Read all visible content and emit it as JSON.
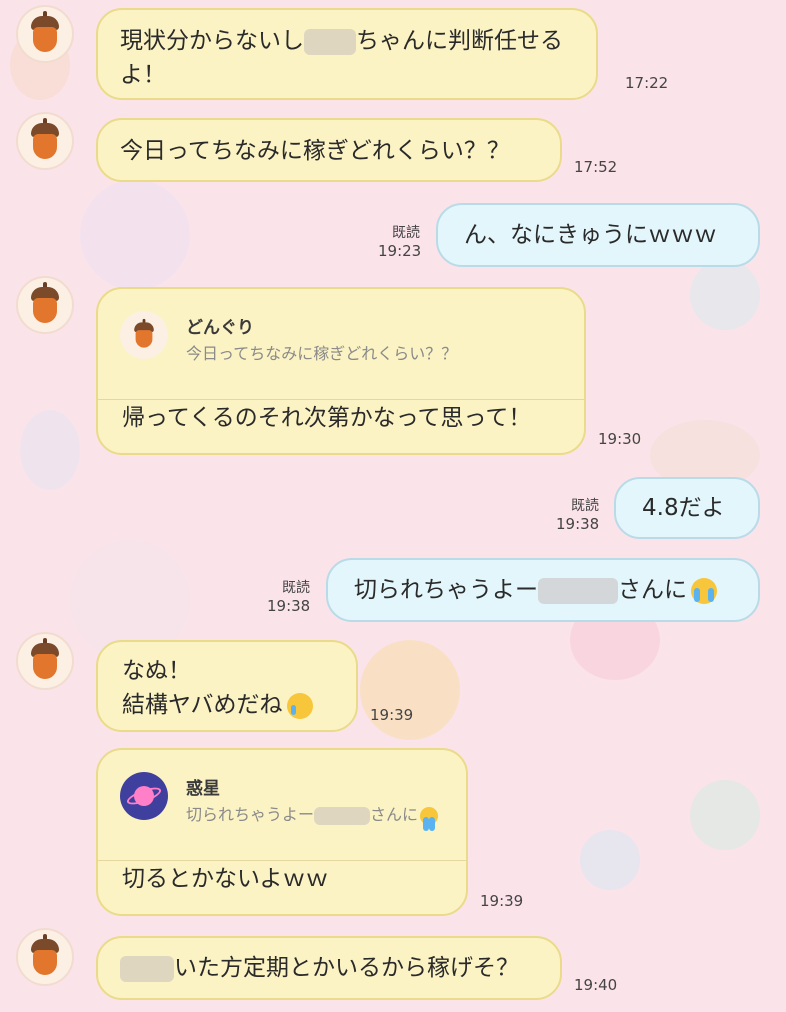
{
  "messages": [
    {
      "text_a": "現状分からないし",
      "text_b": "ちゃんに判断任せる",
      "text_c": "よ！",
      "time": "17:22"
    },
    {
      "text": "今日ってちなみに稼ぎどれくらい？？",
      "time": "17:52"
    },
    {
      "text": "ん、なにきゅうにｗｗｗ",
      "read": "既読",
      "time": "19:23"
    },
    {
      "quote_name": "どんぐり",
      "quote_text": "今日ってちなみに稼ぎどれくらい？？",
      "text": "帰ってくるのそれ次第かなって思って！",
      "time": "19:30"
    },
    {
      "text": "4.8だよ",
      "read": "既読",
      "time": "19:38"
    },
    {
      "text_a": "切られちゃうよー",
      "text_b": "さんに",
      "emoji": "loudly-crying-face",
      "read": "既読",
      "time": "19:38"
    },
    {
      "line1": "なぬ！",
      "line2": "結構ヤバめだね",
      "emoji": "crying-face",
      "time": "19:39"
    },
    {
      "quote_name": "惑星",
      "quote_text_a": "切られちゃうよー",
      "quote_text_b": "さんに",
      "text": "切るとかないよｗｗ",
      "time": "19:39"
    },
    {
      "text_b": "いた方定期とかいるから稼げそ？",
      "time": "19:40"
    }
  ]
}
